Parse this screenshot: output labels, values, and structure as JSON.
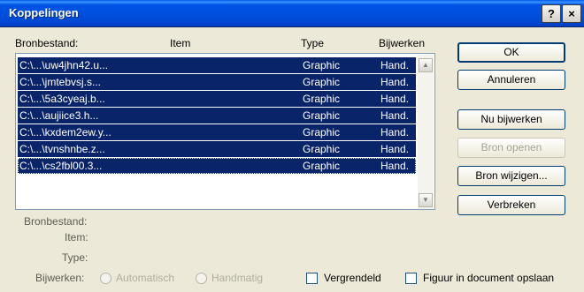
{
  "dialog": {
    "title": "Koppelingen",
    "help_label": "?",
    "close_label": "×"
  },
  "list": {
    "headers": {
      "source": "Bronbestand:",
      "item": "Item",
      "type": "Type",
      "update": "Bijwerken"
    },
    "rows": [
      {
        "source": "C:\\...\\uw4jhn42.u...",
        "type": "Graphic",
        "update": "Hand."
      },
      {
        "source": "C:\\...\\jmtebvsj.s...",
        "type": "Graphic",
        "update": "Hand."
      },
      {
        "source": "C:\\...\\5a3cyeaj.b...",
        "type": "Graphic",
        "update": "Hand."
      },
      {
        "source": "C:\\...\\aujiice3.h...",
        "type": "Graphic",
        "update": "Hand."
      },
      {
        "source": "C:\\...\\kxdem2ew.y...",
        "type": "Graphic",
        "update": "Hand."
      },
      {
        "source": "C:\\...\\tvnshnbe.z...",
        "type": "Graphic",
        "update": "Hand."
      },
      {
        "source": "C:\\...\\cs2fbl00.3...",
        "type": "Graphic",
        "update": "Hand."
      }
    ],
    "scroll_up_icon": "triangle-up",
    "scroll_down_icon": "triangle-down"
  },
  "buttons": {
    "ok": "OK",
    "cancel": "Annuleren",
    "update_now": "Nu bijwerken",
    "open_source": "Bron openen",
    "change_source": "Bron wijzigen...",
    "break": "Verbreken"
  },
  "details": {
    "source_label": "Bronbestand:",
    "item_label": "Item:",
    "type_label": "Type:",
    "update_label": "Bijwerken:",
    "automatic": "Automatisch",
    "manual": "Handmatig",
    "locked": "Vergrendeld",
    "save_picture": "Figuur in document opslaan"
  }
}
